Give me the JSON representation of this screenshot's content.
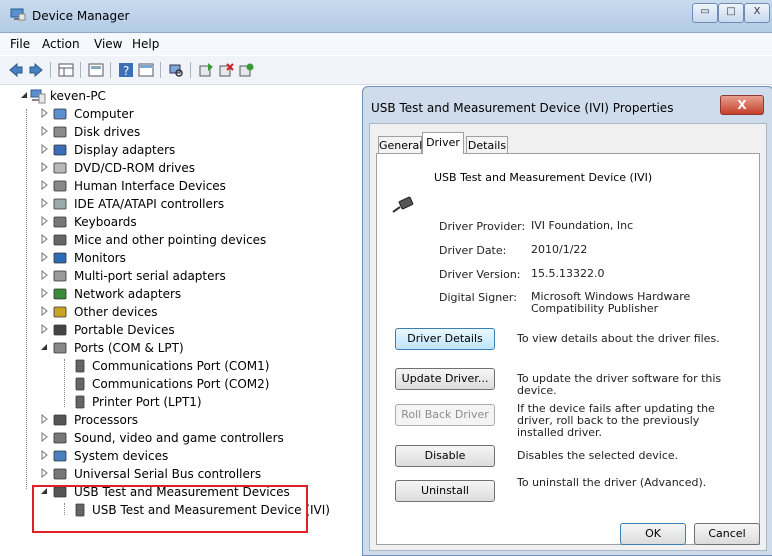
{
  "window": {
    "title": "Device Manager"
  },
  "menu": [
    "File",
    "Action",
    "View",
    "Help"
  ],
  "toolbar": [
    "back-icon",
    "forward-icon",
    "properties-grid-icon",
    "show-hidden-icon",
    "help-icon",
    "device-view-icon",
    "scan-hardware-icon",
    "update-driver-icon",
    "uninstall-icon",
    "enable-icon"
  ],
  "tree": {
    "root": "keven-PC",
    "items": [
      {
        "label": "Computer",
        "icon": "computer-icon"
      },
      {
        "label": "Disk drives",
        "icon": "disk-icon"
      },
      {
        "label": "Display adapters",
        "icon": "display-icon"
      },
      {
        "label": "DVD/CD-ROM drives",
        "icon": "dvd-icon"
      },
      {
        "label": "Human Interface Devices",
        "icon": "hid-icon"
      },
      {
        "label": "IDE ATA/ATAPI controllers",
        "icon": "ide-icon"
      },
      {
        "label": "Keyboards",
        "icon": "keyboard-icon"
      },
      {
        "label": "Mice and other pointing devices",
        "icon": "mouse-icon"
      },
      {
        "label": "Monitors",
        "icon": "monitor-icon"
      },
      {
        "label": "Multi-port serial adapters",
        "icon": "serial-icon"
      },
      {
        "label": "Network adapters",
        "icon": "network-icon"
      },
      {
        "label": "Other devices",
        "icon": "unknown-device-icon"
      },
      {
        "label": "Portable Devices",
        "icon": "portable-icon"
      },
      {
        "label": "Ports (COM & LPT)",
        "icon": "port-icon",
        "children": [
          "Communications Port (COM1)",
          "Communications Port (COM2)",
          "Printer Port (LPT1)"
        ]
      },
      {
        "label": "Processors",
        "icon": "processor-icon"
      },
      {
        "label": "Sound, video and game controllers",
        "icon": "sound-icon"
      },
      {
        "label": "System devices",
        "icon": "system-icon"
      },
      {
        "label": "Universal Serial Bus controllers",
        "icon": "usb-icon"
      },
      {
        "label": "USB Test and Measurement Devices",
        "icon": "usb-device-icon",
        "children": [
          "USB Test and Measurement Device (IVI)"
        ]
      }
    ]
  },
  "dialog": {
    "title": "USB Test and Measurement Device (IVI) Properties",
    "close": "X",
    "tabs": [
      "General",
      "Driver",
      "Details"
    ],
    "device_name": "USB Test and Measurement Device (IVI)",
    "props": [
      {
        "label": "Driver Provider:",
        "value": "IVI Foundation, Inc"
      },
      {
        "label": "Driver Date:",
        "value": "2010/1/22"
      },
      {
        "label": "Driver Version:",
        "value": "15.5.13322.0"
      },
      {
        "label": "Digital Signer:",
        "value": "Microsoft Windows Hardware Compatibility Publisher"
      }
    ],
    "buttons": [
      {
        "label": "Driver Details",
        "desc": "To view details about the driver files."
      },
      {
        "label": "Update Driver...",
        "desc": "To update the driver software for this device."
      },
      {
        "label": "Roll Back Driver",
        "desc": "If the device fails after updating the driver, roll back to the previously installed driver."
      },
      {
        "label": "Disable",
        "desc": "Disables the selected device."
      },
      {
        "label": "Uninstall",
        "desc": "To uninstall the driver (Advanced)."
      }
    ],
    "ok": "OK",
    "cancel": "Cancel"
  },
  "colors": {
    "highlight": "#e01f26",
    "titlebar": "#b9cfe8"
  }
}
